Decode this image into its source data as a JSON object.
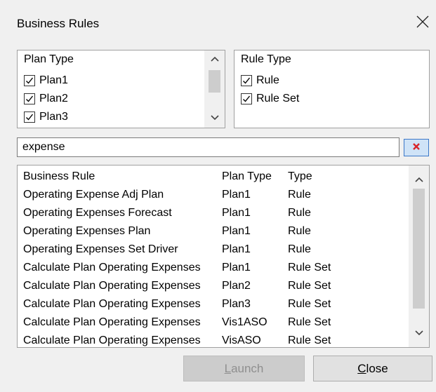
{
  "window": {
    "title": "Business Rules"
  },
  "plan_type_panel": {
    "heading": "Plan Type",
    "items": [
      {
        "label": "Plan1",
        "checked": true
      },
      {
        "label": "Plan2",
        "checked": true
      },
      {
        "label": "Plan3",
        "checked": true
      }
    ]
  },
  "rule_type_panel": {
    "heading": "Rule Type",
    "items": [
      {
        "label": "Rule",
        "checked": true
      },
      {
        "label": "Rule Set",
        "checked": true
      }
    ]
  },
  "search": {
    "value": "expense"
  },
  "rules_table": {
    "headers": [
      "Business Rule",
      "Plan Type",
      "Type"
    ],
    "rows": [
      [
        "Operating Expense Adj Plan",
        "Plan1",
        "Rule"
      ],
      [
        "Operating Expenses Forecast",
        "Plan1",
        "Rule"
      ],
      [
        "Operating Expenses Plan",
        "Plan1",
        "Rule"
      ],
      [
        "Operating Expenses Set Driver",
        "Plan1",
        "Rule"
      ],
      [
        "Calculate Plan Operating Expenses",
        "Plan1",
        "Rule Set"
      ],
      [
        "Calculate Plan Operating Expenses",
        "Plan2",
        "Rule Set"
      ],
      [
        "Calculate Plan Operating Expenses",
        "Plan3",
        "Rule Set"
      ],
      [
        "Calculate Plan Operating Expenses",
        "Vis1ASO",
        "Rule Set"
      ],
      [
        "Calculate Plan Operating Expenses",
        "VisASO",
        "Rule Set"
      ]
    ]
  },
  "buttons": {
    "launch": {
      "mnemonic": "L",
      "rest": "aunch",
      "enabled": false
    },
    "close": {
      "mnemonic": "C",
      "rest": "lose",
      "enabled": true
    }
  },
  "colors": {
    "clear_icon": "#d9252a",
    "clear_button_bg": "#cfe3f7",
    "clear_button_border": "#3c78c8"
  }
}
